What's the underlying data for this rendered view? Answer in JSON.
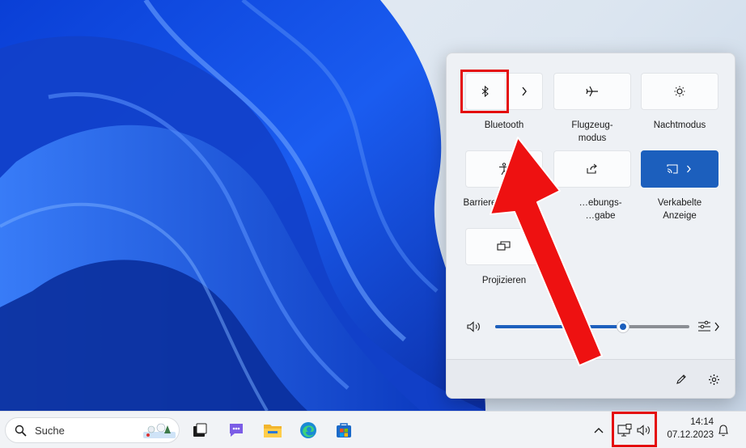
{
  "quick_settings": {
    "tiles": [
      {
        "id": "bluetooth",
        "label": "Bluetooth",
        "icon": "bluetooth-icon",
        "expand_icon": "chevron-right-icon"
      },
      {
        "id": "airplane",
        "label": "Flugzeug-\nmodus",
        "icon": "airplane-icon"
      },
      {
        "id": "nightlight",
        "label": "Nachtmodus",
        "icon": "brightness-icon"
      },
      {
        "id": "accessibility",
        "label": "Barriere",
        "icon": "accessibility-icon"
      },
      {
        "id": "nearby_share",
        "label": "…ebungs-\n…gabe",
        "icon": "share-icon"
      },
      {
        "id": "cast",
        "label": "Verkabelte\nAnzeige",
        "icon": "cast-icon",
        "active": true,
        "expand_icon": "chevron-right-icon"
      },
      {
        "id": "project",
        "label": "Projizieren",
        "icon": "project-icon"
      }
    ],
    "volume": {
      "level_percent": 66,
      "icon": "speaker-icon",
      "end_icon": "audio-mixer-icon"
    },
    "footer": {
      "edit_icon": "pencil-icon",
      "settings_icon": "gear-icon"
    }
  },
  "taskbar": {
    "search_placeholder": "Suche",
    "apps": [
      "task-view-icon",
      "teams-chat-icon",
      "file-explorer-icon",
      "edge-icon",
      "store-icon"
    ],
    "tray": {
      "overflow_icon": "chevron-up-icon",
      "network_icon": "network-icon",
      "volume_icon": "speaker-icon"
    },
    "clock": {
      "time": "14:14",
      "date": "07.12.2023"
    },
    "notification_icon": "bell-icon"
  },
  "colors": {
    "accent": "#1c5fbd",
    "highlight": "#e40d0d"
  }
}
